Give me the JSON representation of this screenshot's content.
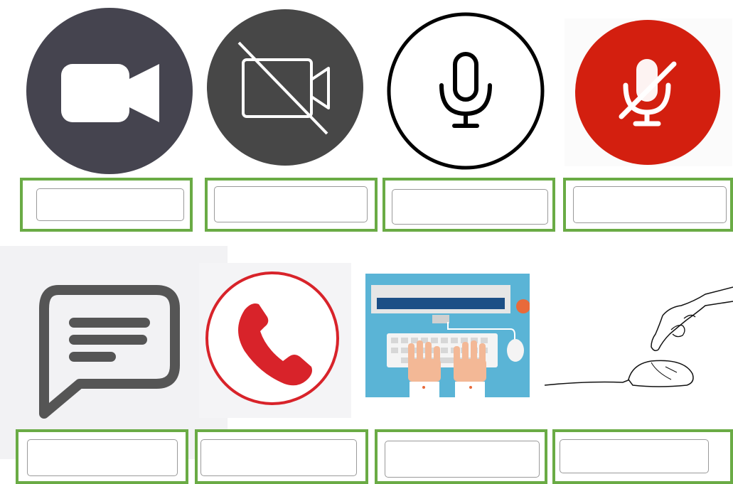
{
  "colors": {
    "answer_border": "#6aab45",
    "video_dark": "#45444f",
    "video_off_dark": "#474747",
    "mic_muted_red": "#d31f0f",
    "call_red": "#d8232a",
    "chat_gray": "#555555"
  },
  "tiles": [
    {
      "icon": "video-camera-icon",
      "answer_value": "",
      "answer_placeholder": ""
    },
    {
      "icon": "video-camera-off-icon",
      "answer_value": "",
      "answer_placeholder": ""
    },
    {
      "icon": "microphone-icon",
      "answer_value": "",
      "answer_placeholder": ""
    },
    {
      "icon": "microphone-muted-icon",
      "answer_value": "",
      "answer_placeholder": ""
    },
    {
      "icon": "chat-bubble-icon",
      "answer_value": "",
      "answer_placeholder": ""
    },
    {
      "icon": "phone-call-icon",
      "answer_value": "",
      "answer_placeholder": ""
    },
    {
      "icon": "keyboard-typing-icon",
      "answer_value": "",
      "answer_placeholder": ""
    },
    {
      "icon": "mouse-click-icon",
      "answer_value": "",
      "answer_placeholder": ""
    }
  ]
}
